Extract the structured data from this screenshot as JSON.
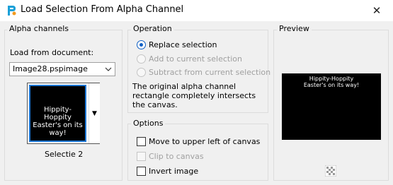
{
  "window": {
    "title": "Load Selection From Alpha Channel",
    "close_glyph": "✕"
  },
  "alpha_channels": {
    "legend": "Alpha channels",
    "load_from_label": "Load from document:",
    "document_value": "Image28.pspimage",
    "thumbnail_text_line1": "Hippity-Hoppity",
    "thumbnail_text_line2": "Easter's on its way!",
    "channel_name": "Selectie 2"
  },
  "operation": {
    "legend": "Operation",
    "options": [
      {
        "label": "Replace selection",
        "checked": true,
        "enabled": true
      },
      {
        "label": "Add to current selection",
        "checked": false,
        "enabled": false
      },
      {
        "label": "Subtract from current selection",
        "checked": false,
        "enabled": false
      }
    ],
    "info": "The original alpha channel rectangle completely intersects the canvas."
  },
  "options": {
    "legend": "Options",
    "items": [
      {
        "label": "Move to upper left of canvas",
        "checked": false,
        "enabled": true
      },
      {
        "label": "Clip to canvas",
        "checked": false,
        "enabled": false
      },
      {
        "label": "Invert image",
        "checked": false,
        "enabled": true
      }
    ]
  },
  "preview": {
    "legend": "Preview",
    "text_line1": "Hippity-Hoppity",
    "text_line2": "Easter's on its way!"
  },
  "colors": {
    "accent": "#0f5fc4",
    "selection_border": "#1e78d6",
    "disabled_text": "#a0a0a0"
  }
}
